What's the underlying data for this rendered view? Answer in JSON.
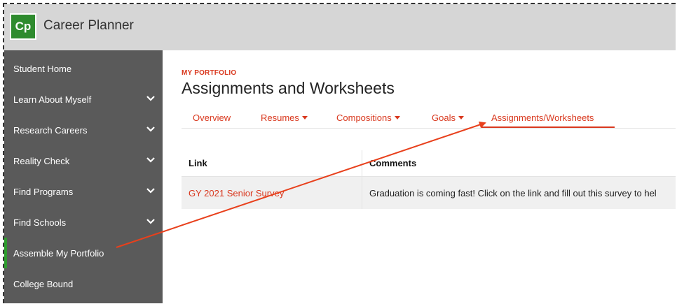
{
  "app": {
    "logo_text": "Cp",
    "title": "Career Planner"
  },
  "sidebar": {
    "items": [
      {
        "label": "Student Home",
        "expandable": false
      },
      {
        "label": "Learn About Myself",
        "expandable": true
      },
      {
        "label": "Research Careers",
        "expandable": true
      },
      {
        "label": "Reality Check",
        "expandable": true
      },
      {
        "label": "Find Programs",
        "expandable": true
      },
      {
        "label": "Find Schools",
        "expandable": true
      },
      {
        "label": "Assemble My Portfolio",
        "expandable": false,
        "active": true
      },
      {
        "label": "College Bound",
        "expandable": false
      }
    ]
  },
  "main": {
    "eyebrow": "MY PORTFOLIO",
    "title": "Assignments and Worksheets",
    "tabs": [
      {
        "label": "Overview",
        "dropdown": false
      },
      {
        "label": "Resumes",
        "dropdown": true
      },
      {
        "label": "Compositions",
        "dropdown": true
      },
      {
        "label": "Goals",
        "dropdown": true
      },
      {
        "label": "Assignments/Worksheets",
        "dropdown": false,
        "active": true
      }
    ],
    "table": {
      "headers": [
        "Link",
        "Comments"
      ],
      "rows": [
        {
          "link": "GY 2021 Senior Survey",
          "comments": "Graduation is coming fast! Click on the link and fill out this survey to hel"
        }
      ]
    }
  },
  "colors": {
    "accent": "#d9381e",
    "brand": "#2e8b2e",
    "sidebar_bg": "#5a5a5a",
    "annotation_arrow": "#e8401c"
  }
}
